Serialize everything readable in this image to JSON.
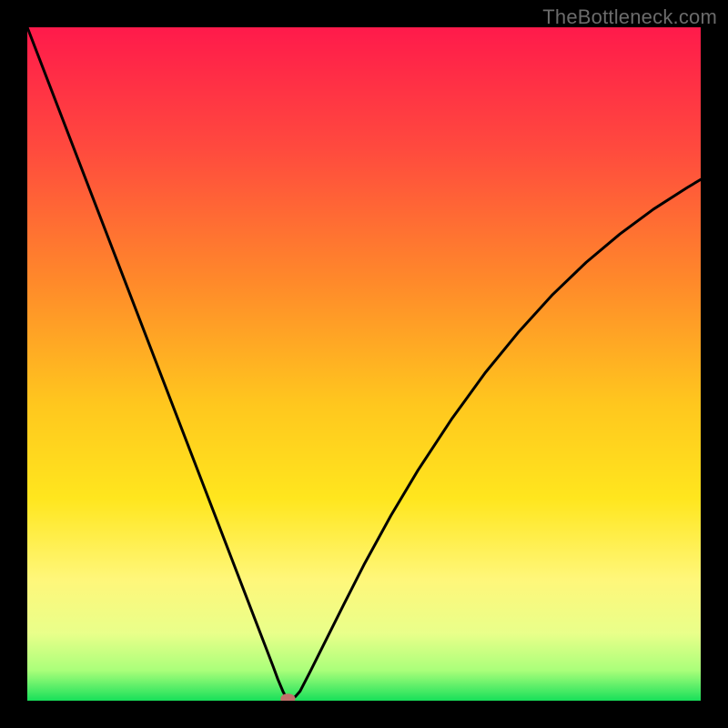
{
  "watermark": "TheBottleneck.com",
  "chart_data": {
    "type": "line",
    "title": "",
    "xlabel": "",
    "ylabel": "",
    "xlim": [
      0,
      100
    ],
    "ylim": [
      0,
      100
    ],
    "background_gradient": {
      "stops": [
        {
          "offset": 0.0,
          "color": "#ff1a4b"
        },
        {
          "offset": 0.18,
          "color": "#ff4a3e"
        },
        {
          "offset": 0.38,
          "color": "#ff8a2a"
        },
        {
          "offset": 0.56,
          "color": "#ffc71e"
        },
        {
          "offset": 0.7,
          "color": "#ffe61e"
        },
        {
          "offset": 0.82,
          "color": "#fff77a"
        },
        {
          "offset": 0.9,
          "color": "#e9ff8a"
        },
        {
          "offset": 0.955,
          "color": "#aaff7a"
        },
        {
          "offset": 1.0,
          "color": "#18e05a"
        }
      ]
    },
    "series": [
      {
        "name": "bottleneck-curve",
        "x": [
          0,
          5,
          10,
          15,
          20,
          25,
          28,
          30,
          32,
          34,
          35.5,
          36.5,
          37.2,
          38,
          38.5,
          39.2,
          39.8,
          40.5,
          42,
          44,
          47,
          50,
          54,
          58,
          63,
          68,
          73,
          78,
          83,
          88,
          93,
          98,
          100
        ],
        "y": [
          100,
          87,
          74,
          61,
          48,
          35,
          27.2,
          22,
          16.8,
          11.6,
          7.7,
          5.1,
          3.2,
          1.3,
          0.4,
          0.2,
          0.6,
          1.4,
          4.3,
          8.3,
          14.3,
          20.2,
          27.5,
          34.2,
          41.8,
          48.7,
          54.8,
          60.3,
          65.1,
          69.3,
          73,
          76.2,
          77.4
        ]
      }
    ],
    "marker": {
      "x": 38.7,
      "y": 0.3,
      "rx": 1.1,
      "ry": 0.75,
      "color": "#c1716b"
    }
  }
}
